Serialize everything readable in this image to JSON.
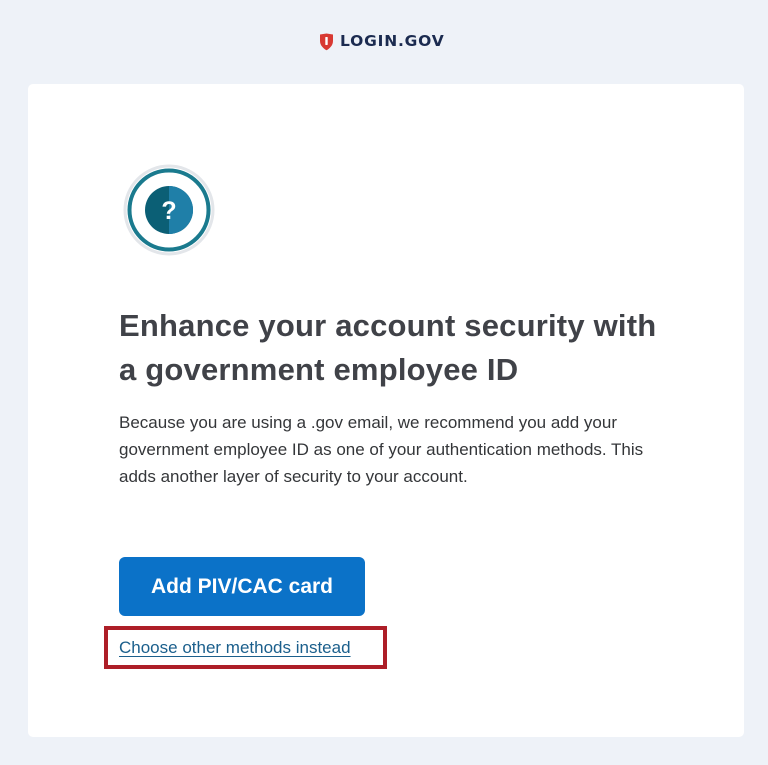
{
  "header": {
    "brand_text": "LOGIN.GOV",
    "brand_icon": "shield-icon",
    "brand_color": "#d83933",
    "brand_text_color": "#1b2b50"
  },
  "main": {
    "badge_icon": "question-icon",
    "badge_glyph": "?",
    "badge_color": "#1a7a8e",
    "headline": "Enhance your account security with a government employee ID",
    "description": "Because you are using a .gov email, we recommend you add your government employee ID as one of your authentication methods. This adds another layer of security to your account.",
    "primary_button_label": "Add PIV/CAC card",
    "primary_button_color": "#0b72c8",
    "alternative_link_label": "Choose other methods instead",
    "link_color": "#1b5f8c",
    "highlight_color": "#ad1e27"
  }
}
